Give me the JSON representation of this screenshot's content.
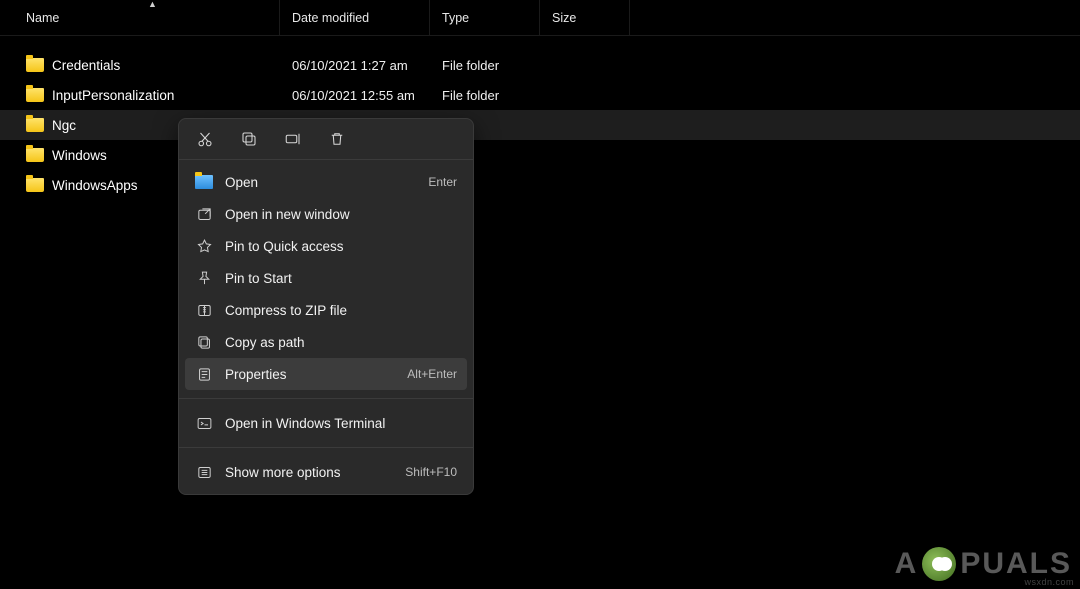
{
  "columns": {
    "name": "Name",
    "date": "Date modified",
    "type": "Type",
    "size": "Size"
  },
  "rows": [
    {
      "name": "Credentials",
      "date": "06/10/2021 1:27 am",
      "type": "File folder",
      "size": "",
      "selected": false
    },
    {
      "name": "InputPersonalization",
      "date": "06/10/2021 12:55 am",
      "type": "File folder",
      "size": "",
      "selected": false
    },
    {
      "name": "Ngc",
      "date": "",
      "type": "",
      "size": "",
      "selected": true
    },
    {
      "name": "Windows",
      "date": "",
      "type": "",
      "size": "",
      "selected": false
    },
    {
      "name": "WindowsApps",
      "date": "",
      "type": "",
      "size": "",
      "selected": false
    }
  ],
  "context_menu": {
    "icon_row": [
      "cut-icon",
      "copy-icon",
      "rename-icon",
      "delete-icon"
    ],
    "groups": [
      [
        {
          "icon": "open",
          "label": "Open",
          "hint": "Enter",
          "highlight": false
        },
        {
          "icon": "new-window",
          "label": "Open in new window",
          "hint": "",
          "highlight": false
        },
        {
          "icon": "star",
          "label": "Pin to Quick access",
          "hint": "",
          "highlight": false
        },
        {
          "icon": "pin",
          "label": "Pin to Start",
          "hint": "",
          "highlight": false
        },
        {
          "icon": "zip",
          "label": "Compress to ZIP file",
          "hint": "",
          "highlight": false
        },
        {
          "icon": "copy-path",
          "label": "Copy as path",
          "hint": "",
          "highlight": false
        },
        {
          "icon": "properties",
          "label": "Properties",
          "hint": "Alt+Enter",
          "highlight": true
        }
      ],
      [
        {
          "icon": "terminal",
          "label": "Open in Windows Terminal",
          "hint": "",
          "highlight": false
        }
      ],
      [
        {
          "icon": "more",
          "label": "Show more options",
          "hint": "Shift+F10",
          "highlight": false
        }
      ]
    ]
  },
  "watermark": {
    "left": "A",
    "right": "PUALS"
  },
  "credit": "wsxdn.com"
}
